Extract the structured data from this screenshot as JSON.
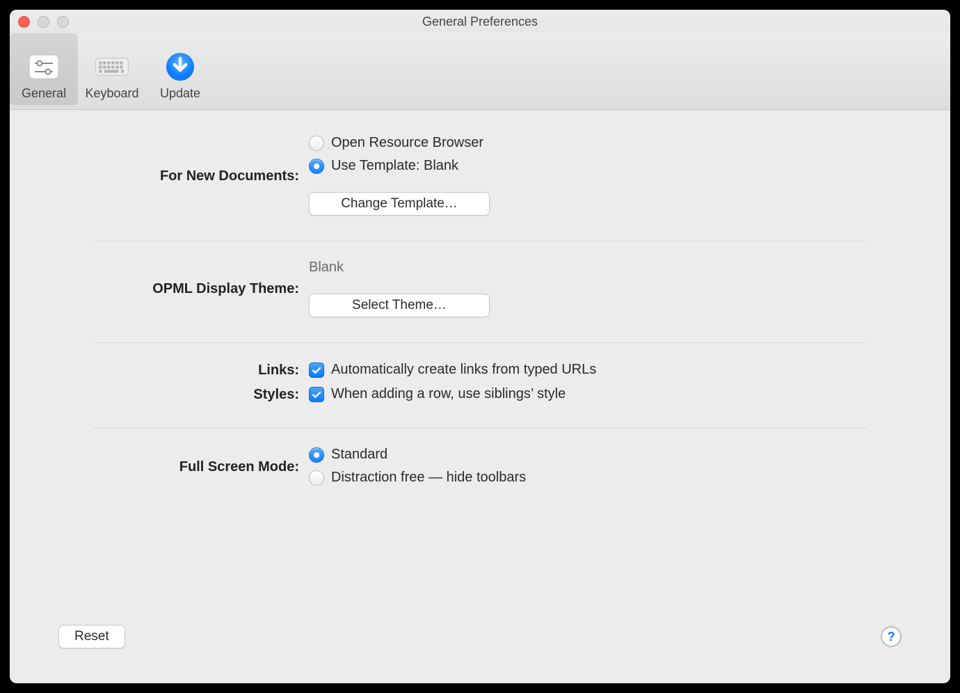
{
  "window": {
    "title": "General Preferences"
  },
  "toolbar": {
    "items": [
      {
        "label": "General",
        "selected": true
      },
      {
        "label": "Keyboard",
        "selected": false
      },
      {
        "label": "Update",
        "selected": false
      }
    ]
  },
  "sections": {
    "newDocuments": {
      "label": "For New Documents:",
      "options": {
        "openResource": "Open Resource Browser",
        "useTemplate": "Use Template: Blank"
      },
      "selected": "useTemplate",
      "changeTemplateButton": "Change Template…"
    },
    "opml": {
      "label": "OPML Display Theme:",
      "value": "Blank",
      "selectThemeButton": "Select Theme…"
    },
    "links": {
      "label": "Links:",
      "checkboxLabel": "Automatically create links from typed URLs",
      "checked": true
    },
    "styles": {
      "label": "Styles:",
      "checkboxLabel": "When adding a row, use siblings’ style",
      "checked": true
    },
    "fullscreen": {
      "label": "Full Screen Mode:",
      "options": {
        "standard": "Standard",
        "distractionFree": "Distraction free — hide toolbars"
      },
      "selected": "standard"
    }
  },
  "footer": {
    "reset": "Reset",
    "help": "?"
  }
}
